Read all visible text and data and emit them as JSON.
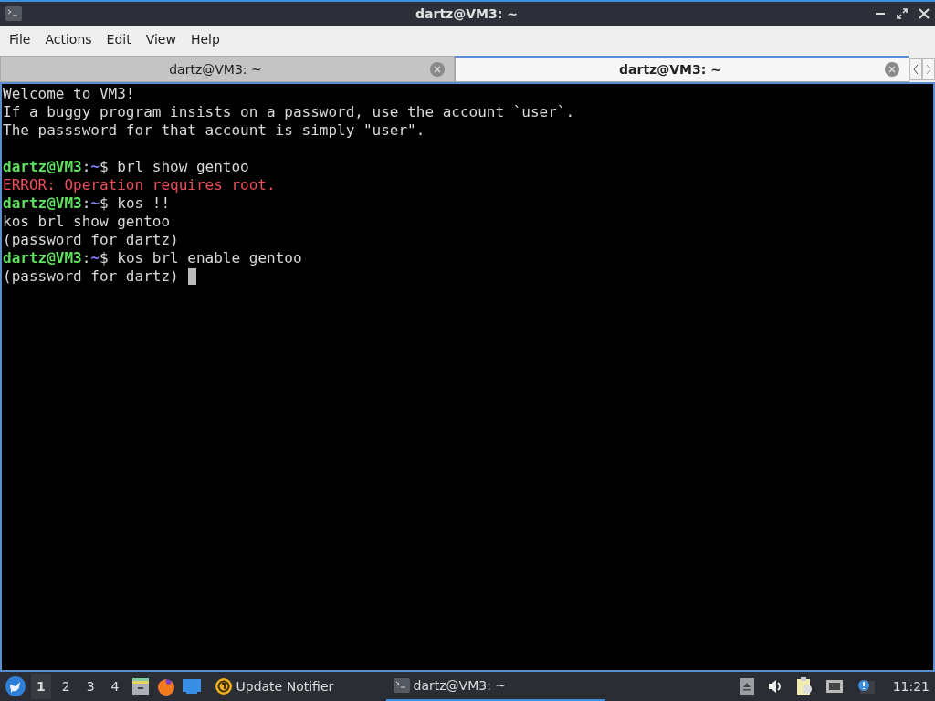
{
  "window": {
    "title": "dartz@VM3: ~"
  },
  "menu": [
    "File",
    "Actions",
    "Edit",
    "View",
    "Help"
  ],
  "tabs": [
    {
      "label": "dartz@VM3: ~",
      "selected": false
    },
    {
      "label": "dartz@VM3: ~",
      "selected": true
    }
  ],
  "terminal": {
    "lines": [
      {
        "kind": "text",
        "text": "Welcome to VM3!"
      },
      {
        "kind": "text",
        "text": "If a buggy program insists on a password, use the account `user`."
      },
      {
        "kind": "text",
        "text": "The passsword for that account is simply \"user\"."
      },
      {
        "kind": "blank"
      },
      {
        "kind": "prompt",
        "user": "dartz@VM3",
        "sep": ":",
        "path": "~",
        "command": "$ brl show gentoo"
      },
      {
        "kind": "error",
        "text": "ERROR: Operation requires root."
      },
      {
        "kind": "prompt",
        "user": "dartz@VM3",
        "sep": ":",
        "path": "~",
        "command": "$ kos !!"
      },
      {
        "kind": "text",
        "text": "kos brl show gentoo"
      },
      {
        "kind": "text",
        "text": "(password for dartz)"
      },
      {
        "kind": "prompt",
        "user": "dartz@VM3",
        "sep": ":",
        "path": "~",
        "command": "$ kos brl enable gentoo"
      },
      {
        "kind": "text",
        "text": "(password for dartz)",
        "cursor": true
      }
    ]
  },
  "taskbar": {
    "desktops": [
      {
        "label": "1",
        "selected": true
      },
      {
        "label": "2",
        "selected": false
      },
      {
        "label": "3",
        "selected": false
      },
      {
        "label": "4",
        "selected": false
      }
    ],
    "tasks": [
      {
        "kind": "notifier",
        "label": "Update Notifier",
        "selected": false
      },
      {
        "kind": "terminal",
        "label": "dartz@VM3: ~",
        "selected": true
      }
    ],
    "clock": "11:21"
  }
}
